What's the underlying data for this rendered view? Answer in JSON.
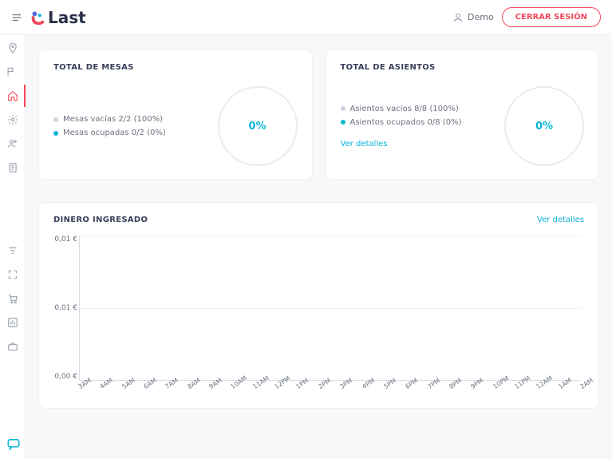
{
  "header": {
    "brand": "Last",
    "user_label": "Demo",
    "logout_label": "CERRAR SESIÓN"
  },
  "cards": {
    "mesas": {
      "title": "TOTAL DE MESAS",
      "empty": "Mesas vacías 2/2 (100%)",
      "occupied": "Mesas ocupadas 0/2 (0%)",
      "pct": "0%"
    },
    "asientos": {
      "title": "TOTAL DE ASIENTOS",
      "empty": "Asientos vacíos 8/8 (100%)",
      "occupied": "Asientos ocupados 0/8 (0%)",
      "pct": "0%",
      "details": "Ver detalles"
    }
  },
  "money": {
    "title": "DINERO INGRESADO",
    "details": "Ver detalles"
  },
  "chart_data": {
    "type": "line",
    "title": "DINERO INGRESADO",
    "xlabel": "",
    "ylabel": "",
    "ylim": [
      0,
      0.01
    ],
    "y_ticks": [
      "0,01 €",
      "0,01 €",
      "0,00 €"
    ],
    "categories": [
      "3AM",
      "4AM",
      "5AM",
      "6AM",
      "7AM",
      "8AM",
      "9AM",
      "10AM",
      "11AM",
      "12PM",
      "1PM",
      "2PM",
      "3PM",
      "4PM",
      "5PM",
      "6PM",
      "7PM",
      "8PM",
      "9PM",
      "10PM",
      "11PM",
      "12AM",
      "1AM",
      "2AM"
    ],
    "values": [
      0,
      0,
      0,
      0,
      0,
      0,
      0,
      0,
      0,
      0,
      0,
      0,
      0,
      0,
      0,
      0,
      0,
      0,
      0,
      0,
      0,
      0,
      0,
      0
    ]
  }
}
